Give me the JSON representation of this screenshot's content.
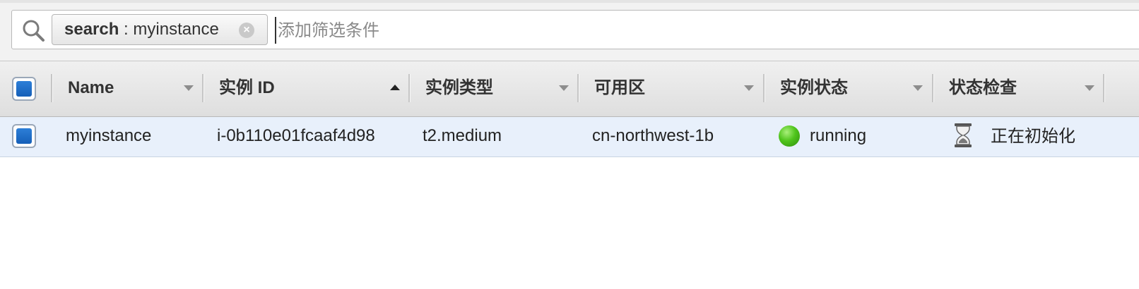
{
  "filter": {
    "token_key": "search",
    "token_separator": " : ",
    "token_value": "myinstance",
    "token_close_icon": "×",
    "placeholder": "添加筛选条件"
  },
  "columns": [
    {
      "label": "Name",
      "sort": "none"
    },
    {
      "label": "实例 ID",
      "sort": "ascending"
    },
    {
      "label": "实例类型",
      "sort": "none"
    },
    {
      "label": "可用区",
      "sort": "none"
    },
    {
      "label": "实例状态",
      "sort": "none"
    },
    {
      "label": "状态检查",
      "sort": "none"
    }
  ],
  "rows": [
    {
      "selected": true,
      "name": "myinstance",
      "instance_id": "i-0b110e01fcaaf4d98",
      "instance_type": "t2.medium",
      "availability_zone": "cn-northwest-1b",
      "instance_state": "running",
      "instance_state_color": "#4fc41c",
      "status_check": "正在初始化",
      "status_check_icon": "hourglass-icon"
    }
  ],
  "colors": {
    "checkbox_fill": "#1f6fcb",
    "row_selected_bg": "#e8f0fb",
    "header_bg": "#e6e6e6"
  }
}
